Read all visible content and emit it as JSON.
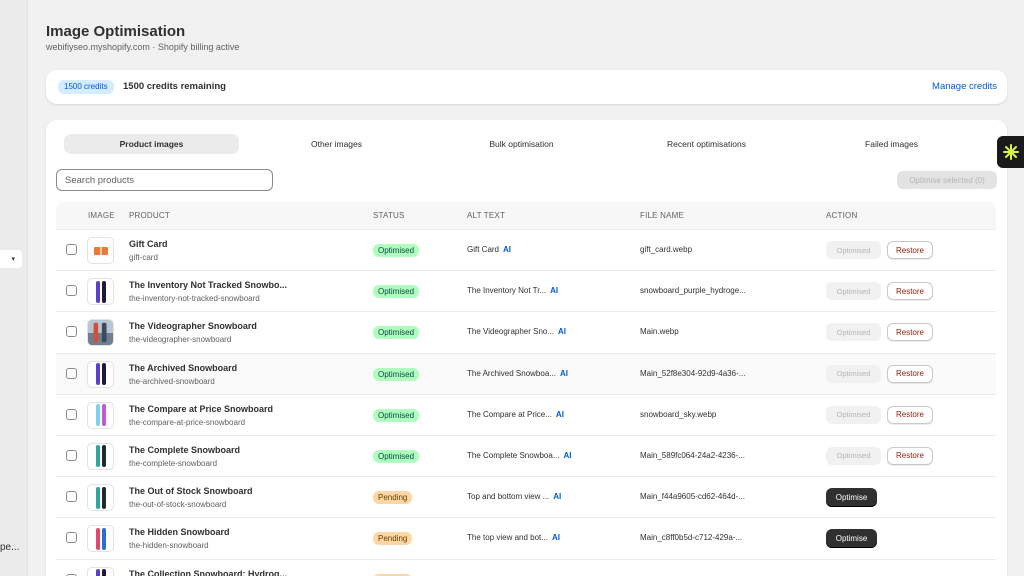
{
  "page": {
    "title": "Image Optimisation",
    "subtitle": "webifiyseo.myshopify.com · Shopify billing active"
  },
  "sidebar": {
    "caret": "▾",
    "bottom_text": "ре..."
  },
  "credits": {
    "badge": "1500 credits",
    "remaining": "1500 credits remaining",
    "manage_link": "Manage credits"
  },
  "tabs": [
    "Product images",
    "Other images",
    "Bulk optimisation",
    "Recent optimisations",
    "Failed images"
  ],
  "active_tab": 0,
  "search": {
    "placeholder": "Search products"
  },
  "optimise_selected": "Optimise selected (0)",
  "table": {
    "headers": {
      "image": "IMAGE",
      "product": "PRODUCT",
      "status": "STATUS",
      "alt_text": "ALT TEXT",
      "file_name": "FILE NAME",
      "action": "ACTION"
    },
    "ai_label": "AI",
    "restore_label": "Restore",
    "optimised_label": "Optimised",
    "optimise_label": "Optimise",
    "rows": [
      {
        "name": "Gift Card",
        "handle": "gift-card",
        "status": "Optimised",
        "alt": "Gift Card",
        "file": "gift_card.webp",
        "thumb": "gift"
      },
      {
        "name": "The Inventory Not Tracked Snowbo...",
        "handle": "the-inventory-not-tracked-snowboard",
        "status": "Optimised",
        "alt": "The Inventory Not Tr...",
        "file": "snowboard_purple_hydroge...",
        "thumb": "purple"
      },
      {
        "name": "The Videographer Snowboard",
        "handle": "the-videographer-snowboard",
        "status": "Optimised",
        "alt": "The Videographer Sno...",
        "file": "Main.webp",
        "thumb": "photo"
      },
      {
        "name": "The Archived Snowboard",
        "handle": "the-archived-snowboard",
        "status": "Optimised",
        "alt": "The Archived Snowboa...",
        "file": "Main_52f8e304-92d9-4a36-...",
        "thumb": "purple"
      },
      {
        "name": "The Compare at Price Snowboard",
        "handle": "the-compare-at-price-snowboard",
        "status": "Optimised",
        "alt": "The Compare at Price...",
        "file": "snowboard_sky.webp",
        "thumb": "sky"
      },
      {
        "name": "The Complete Snowboard",
        "handle": "the-complete-snowboard",
        "status": "Optimised",
        "alt": "The Complete Snowboa...",
        "file": "Main_589fc064-24a2-4236-...",
        "thumb": "teal"
      },
      {
        "name": "The Out of Stock Snowboard",
        "handle": "the-out-of-stock-snowboard",
        "status": "Pending",
        "alt": "Top and bottom view ...",
        "file": "Main_f44a9605-cd62-464d-...",
        "thumb": "teal"
      },
      {
        "name": "The Hidden Snowboard",
        "handle": "the-hidden-snowboard",
        "status": "Pending",
        "alt": "The top view and bot...",
        "file": "Main_c8ff0b5d-c712-429a-...",
        "thumb": "multi"
      },
      {
        "name": "The Collection Snowboard: Hydrog...",
        "handle": "",
        "status": "Pending",
        "alt": "",
        "file": "",
        "thumb": "purple"
      }
    ]
  },
  "colors": {
    "accent": "#005bd3",
    "optimised_bg": "#affebf",
    "pending_bg": "#ffd6a4",
    "restore_text": "#8e1f0b",
    "widget_icon": "#d4f542"
  }
}
